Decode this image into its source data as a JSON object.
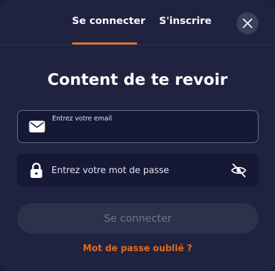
{
  "tabs": {
    "login_label": "Se connecter",
    "signup_label": "S'inscrire",
    "active": "login"
  },
  "header": {
    "close_icon": "close-icon"
  },
  "title": "Content de te revoir",
  "email": {
    "label": "Entrez votre email",
    "value": "",
    "icon": "envelope-icon"
  },
  "password": {
    "placeholder": "Entrez votre mot de passe",
    "value": "",
    "icon": "lock-icon",
    "toggle_icon": "eye-slash-icon"
  },
  "submit_label": "Se connecter",
  "forgot_label": "Mot de passe oublié ?",
  "colors": {
    "accent": "#e8742a",
    "background": "#1f2340",
    "field_background": "#151935",
    "button_disabled": "#2d3149"
  }
}
